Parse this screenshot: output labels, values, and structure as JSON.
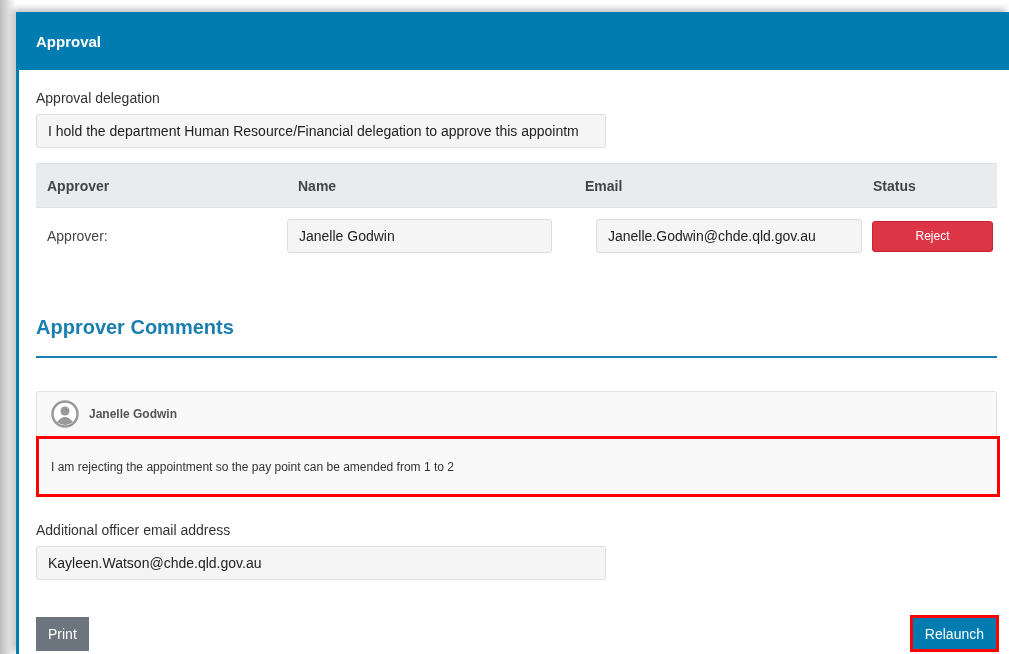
{
  "panel": {
    "title": "Approval"
  },
  "delegation": {
    "label": "Approval delegation",
    "value": "I hold the department Human Resource/Financial delegation to approve this appointm"
  },
  "table": {
    "columns": [
      "Approver",
      "Name",
      "Email",
      "Status"
    ],
    "rows": [
      {
        "role": "Approver:",
        "name": "Janelle Godwin",
        "email": "Janelle.Godwin@chde.qld.gov.au",
        "status_button": "Reject"
      }
    ]
  },
  "comments": {
    "title": "Approver Comments",
    "items": [
      {
        "author": "Janelle Godwin",
        "text": "I am rejecting the appointment so the pay point can be amended from 1 to 2",
        "highlighted": true
      }
    ]
  },
  "additional_email": {
    "label": "Additional officer email address",
    "value": "Kayleen.Watson@chde.qld.gov.au"
  },
  "buttons": [
    {
      "kind": "secondary",
      "label": "Print",
      "highlighted": false
    },
    {
      "kind": "primary",
      "label": "Relaunch",
      "highlighted": true
    }
  ]
}
